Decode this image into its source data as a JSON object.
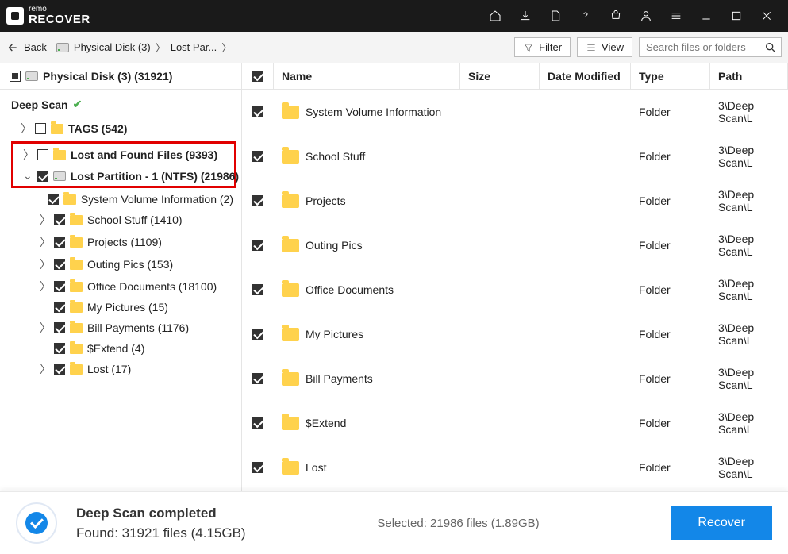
{
  "app": {
    "brand_top": "remo",
    "brand_main": "RECOVER"
  },
  "toolbar": {
    "back": "Back",
    "crumb_disk": "Physical Disk (3)",
    "crumb_lost": "Lost Par...",
    "filter": "Filter",
    "view": "View",
    "search_placeholder": "Search files or folders"
  },
  "sidebar": {
    "root": "Physical Disk (3) (31921)",
    "deep_scan": "Deep Scan",
    "tags": "TAGS (542)",
    "lost_found": "Lost and Found Files (9393)",
    "lost_part": "Lost Partition - 1 (NTFS) (21986)",
    "children": [
      "System Volume Information (2)",
      "School Stuff (1410)",
      "Projects (1109)",
      "Outing Pics (153)",
      "Office Documents (18100)",
      "My Pictures (15)",
      "Bill Payments (1176)",
      "$Extend (4)",
      "Lost (17)"
    ]
  },
  "columns": {
    "name": "Name",
    "size": "Size",
    "date": "Date Modified",
    "type": "Type",
    "path": "Path"
  },
  "rows": [
    {
      "name": "System Volume Information",
      "size": "",
      "date": "",
      "type": "Folder",
      "path": "3\\Deep Scan\\L"
    },
    {
      "name": "School Stuff",
      "size": "",
      "date": "",
      "type": "Folder",
      "path": "3\\Deep Scan\\L"
    },
    {
      "name": "Projects",
      "size": "",
      "date": "",
      "type": "Folder",
      "path": "3\\Deep Scan\\L"
    },
    {
      "name": "Outing Pics",
      "size": "",
      "date": "",
      "type": "Folder",
      "path": "3\\Deep Scan\\L"
    },
    {
      "name": "Office Documents",
      "size": "",
      "date": "",
      "type": "Folder",
      "path": "3\\Deep Scan\\L"
    },
    {
      "name": "My Pictures",
      "size": "",
      "date": "",
      "type": "Folder",
      "path": "3\\Deep Scan\\L"
    },
    {
      "name": "Bill Payments",
      "size": "",
      "date": "",
      "type": "Folder",
      "path": "3\\Deep Scan\\L"
    },
    {
      "name": "$Extend",
      "size": "",
      "date": "",
      "type": "Folder",
      "path": "3\\Deep Scan\\L"
    },
    {
      "name": "Lost",
      "size": "",
      "date": "",
      "type": "Folder",
      "path": "3\\Deep Scan\\L"
    }
  ],
  "footer": {
    "status_title": "Deep Scan completed",
    "status_sub": "Found: 31921 files (4.15GB)",
    "selected": "Selected: 21986 files (1.89GB)",
    "recover": "Recover"
  }
}
